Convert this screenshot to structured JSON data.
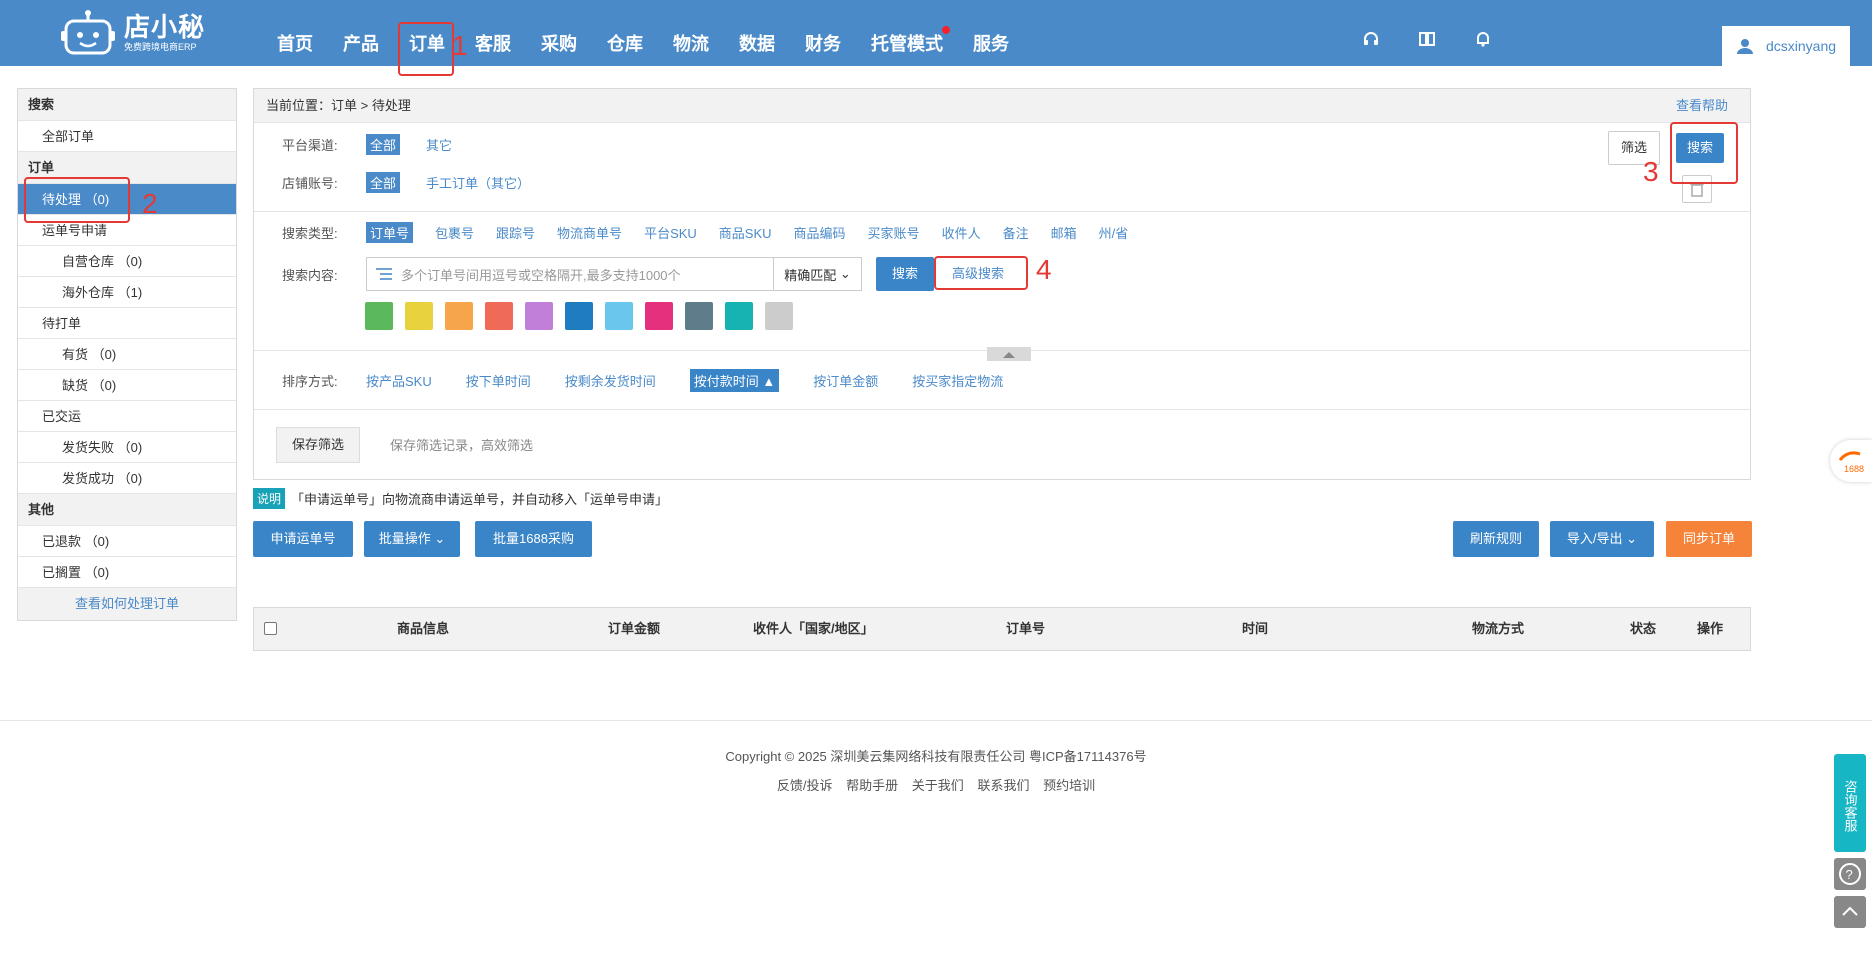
{
  "header": {
    "logo_title": "店小秘",
    "logo_sub": "免费跨境电商ERP",
    "nav": [
      "首页",
      "产品",
      "订单",
      "客服",
      "采购",
      "仓库",
      "物流",
      "数据",
      "财务",
      "托管模式",
      "服务"
    ],
    "username": "dcsxinyang"
  },
  "sidebar": {
    "search_head": "搜索",
    "all_orders": "全部订单",
    "order_head": "订单",
    "items": [
      {
        "label": "待处理 （0)",
        "sub": false,
        "active": true
      },
      {
        "label": "运单号申请",
        "sub": false
      },
      {
        "label": "自营仓库 （0)",
        "sub": true
      },
      {
        "label": "海外仓库 （1)",
        "sub": true
      },
      {
        "label": "待打单",
        "sub": false
      },
      {
        "label": "有货 （0)",
        "sub": true
      },
      {
        "label": "缺货 （0)",
        "sub": true
      },
      {
        "label": "已交运",
        "sub": false
      },
      {
        "label": "发货失败 （0)",
        "sub": true
      },
      {
        "label": "发货成功 （0)",
        "sub": true
      }
    ],
    "other_head": "其他",
    "other_items": [
      "已退款 （0)",
      "已搁置 （0)"
    ],
    "help_link": "查看如何处理订单"
  },
  "crumb": {
    "prefix": "当前位置：",
    "path": "订单 > 待处理",
    "help": "查看帮助"
  },
  "filters": {
    "platform_label": "平台渠道:",
    "platform_all": "全部",
    "platform_other": "其它",
    "shop_label": "店铺账号:",
    "shop_all": "全部",
    "shop_manual": "手工订单（其它）",
    "filter_btn": "筛选",
    "search_btn": "搜索"
  },
  "search": {
    "type_label": "搜索类型:",
    "types": [
      "订单号",
      "包裹号",
      "跟踪号",
      "物流商单号",
      "平台SKU",
      "商品SKU",
      "商品编码",
      "买家账号",
      "收件人",
      "备注",
      "邮箱",
      "州/省"
    ],
    "content_label": "搜索内容:",
    "placeholder": "多个订单号间用逗号或空格隔开,最多支持1000个",
    "match": "精确匹配",
    "button": "搜索",
    "advanced": "高级搜索",
    "colors": [
      "#5cb85c",
      "#e8d33f",
      "#f7a54a",
      "#ef6b57",
      "#c27fd9",
      "#1f7cc1",
      "#6ac6ec",
      "#e5307d",
      "#5e7c8a",
      "#17b3b3",
      "#cccccc"
    ]
  },
  "sort": {
    "label": "排序方式:",
    "options": [
      "按产品SKU",
      "按下单时间",
      "按剩余发货时间",
      "按付款时间 ▲",
      "按订单金额",
      "按买家指定物流"
    ]
  },
  "save": {
    "button": "保存筛选",
    "tip": "保存筛选记录，高效筛选"
  },
  "notice": {
    "tag": "说明",
    "text": "「申请运单号」向物流商申请运单号，并自动移入「运单号申请」"
  },
  "actions": {
    "apply": "申请运单号",
    "batch": "批量操作",
    "batch1688": "批量1688采购",
    "refresh": "刷新规则",
    "import": "导入/导出",
    "sync": "同步订单"
  },
  "table_headers": [
    "商品信息",
    "订单金额",
    "收件人「国家/地区」",
    "订单号",
    "时间",
    "物流方式",
    "状态",
    "操作"
  ],
  "footer": {
    "copyright": "Copyright © 2025 深圳美云集网络科技有限责任公司  粤ICP备17114376号",
    "links": [
      "反馈/投诉",
      "帮助手册",
      "关于我们",
      "联系我们",
      "预约培训"
    ]
  },
  "float": {
    "consult": "咨询客服",
    "ali": "1688"
  },
  "annotations": [
    "1",
    "2",
    "3",
    "4"
  ]
}
